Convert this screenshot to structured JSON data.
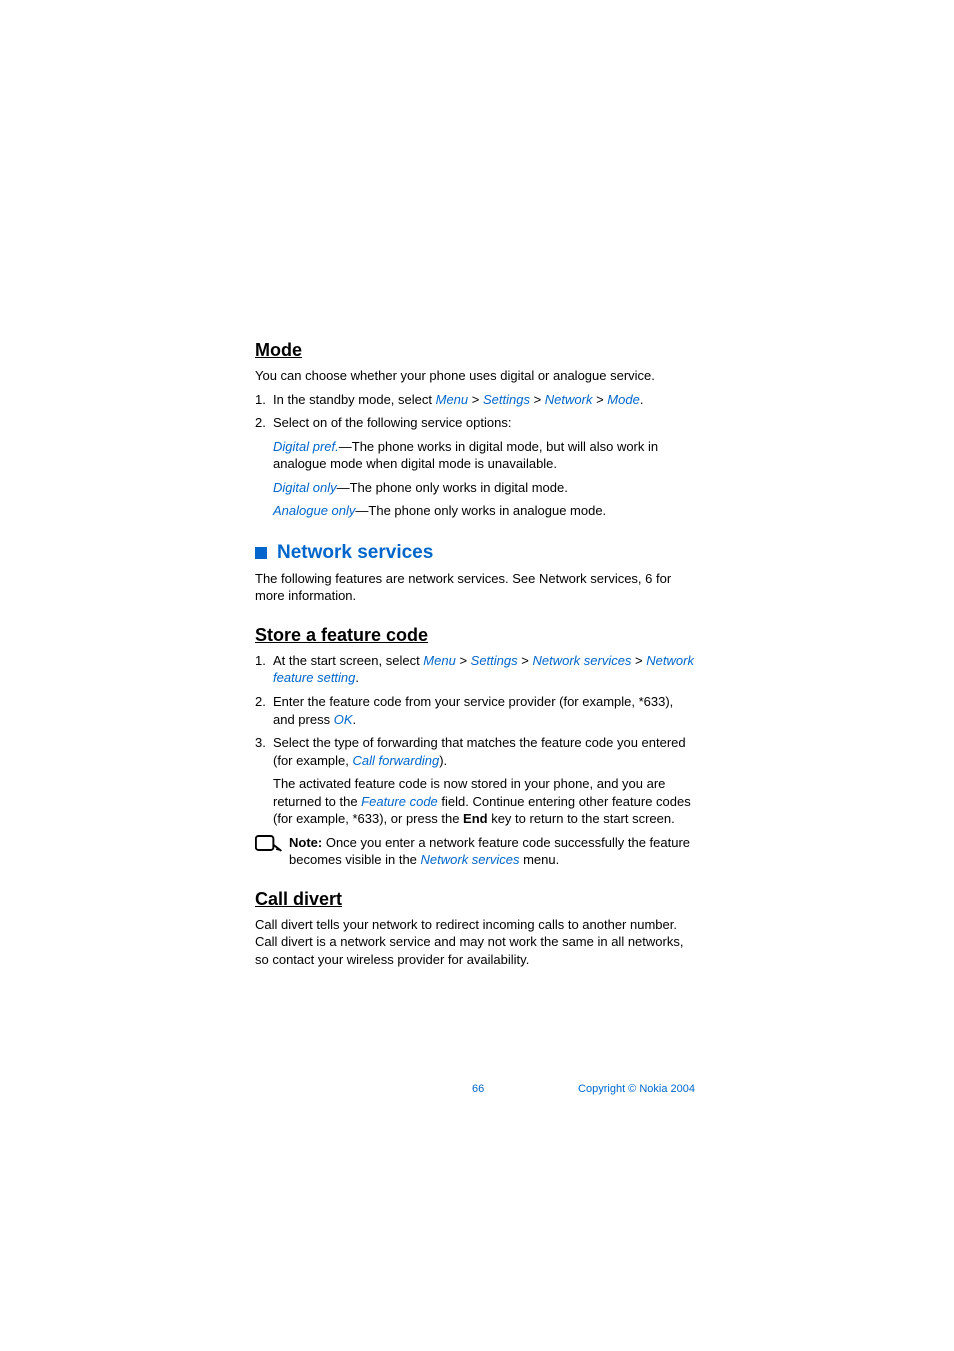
{
  "mode": {
    "heading": "Mode",
    "intro": "You can choose whether your phone uses digital or analogue service.",
    "step1_prefix": "In the standby mode, select ",
    "step1_links": {
      "menu": "Menu",
      "settings": "Settings",
      "network": "Network",
      "mode": "Mode"
    },
    "step2": "Select on of the following service options:",
    "opt1_link": "Digital pref.",
    "opt1_rest": "—The phone works in digital mode, but will also work in analogue mode when digital mode is unavailable.",
    "opt2_link": "Digital only",
    "opt2_rest": "—The phone only works in digital mode.",
    "opt3_link": "Analogue only",
    "opt3_rest": "—The phone only works in analogue mode."
  },
  "network_services": {
    "heading": "Network services",
    "intro": "The following features are network services. See Network services, 6 for more information."
  },
  "store_feature_code": {
    "heading": "Store a feature code",
    "step1_prefix": "At the start screen, select ",
    "step1_links": {
      "menu": "Menu",
      "settings": "Settings",
      "network_services": "Network services",
      "network_feature_setting": "Network feature setting"
    },
    "step2_prefix": "Enter the feature code from your service provider (for example, *633), and press ",
    "step2_link": "OK",
    "step3_prefix": "Select the type of forwarding that matches the feature code you entered (for example, ",
    "step3_link": "Call forwarding",
    "step3_suffix": ").",
    "para1_prefix": "The activated feature code is now stored in your phone, and you are returned to the ",
    "para1_link": "Feature code",
    "para1_mid": " field. Continue entering other feature codes (for example, *633), or press the ",
    "para1_bold": "End",
    "para1_suffix": " key to return to the start screen.",
    "note_label": "Note:",
    "note_prefix": " Once you enter a network feature code successfully the feature becomes visible in the ",
    "note_link": "Network services",
    "note_suffix": " menu."
  },
  "call_divert": {
    "heading": "Call divert",
    "body": "Call divert tells your network to redirect incoming calls to another number. Call divert is a network service and may not work the same in all networks, so contact your wireless provider for availability."
  },
  "footer": {
    "page": "66",
    "copyright": "Copyright © Nokia 2004"
  },
  "sep": " > ",
  "period": "."
}
